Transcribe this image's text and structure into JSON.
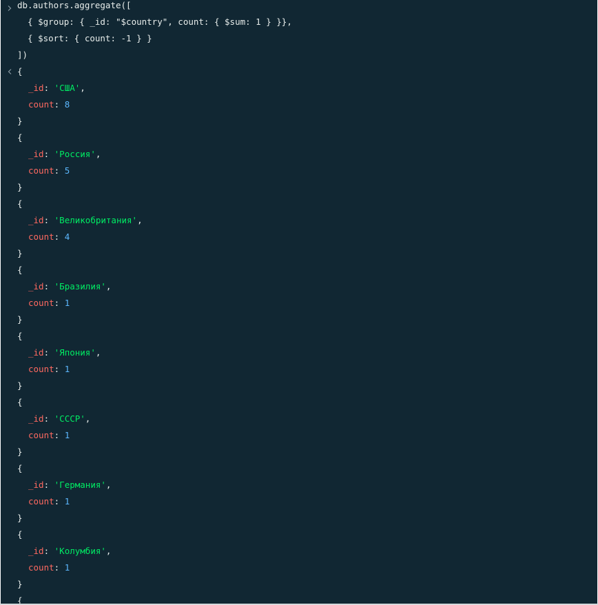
{
  "input": {
    "lines": [
      "db.authors.aggregate([",
      "  { $group: { _id: \"$country\", count: { $sum: 1 } }},",
      "  { $sort: { count: -1 } }",
      "])"
    ]
  },
  "result": {
    "id_key": "_id",
    "count_key": "count",
    "open_brace": "{",
    "close_brace": "}",
    "documents": [
      {
        "id": "'США'",
        "count": "8"
      },
      {
        "id": "'Россия'",
        "count": "5"
      },
      {
        "id": "'Великобритания'",
        "count": "4"
      },
      {
        "id": "'Бразилия'",
        "count": "1"
      },
      {
        "id": "'Япония'",
        "count": "1"
      },
      {
        "id": "'СССР'",
        "count": "1"
      },
      {
        "id": "'Германия'",
        "count": "1"
      },
      {
        "id": "'Колумбия'",
        "count": "1"
      }
    ],
    "trailing_brace": "{"
  },
  "colors": {
    "background": "#112733",
    "key": "#ff6960",
    "string": "#00ed64",
    "number": "#5cb8ff",
    "text": "#e8edeb"
  },
  "icons": {
    "prompt": "chevron-right-icon",
    "result": "chevron-left-icon"
  }
}
